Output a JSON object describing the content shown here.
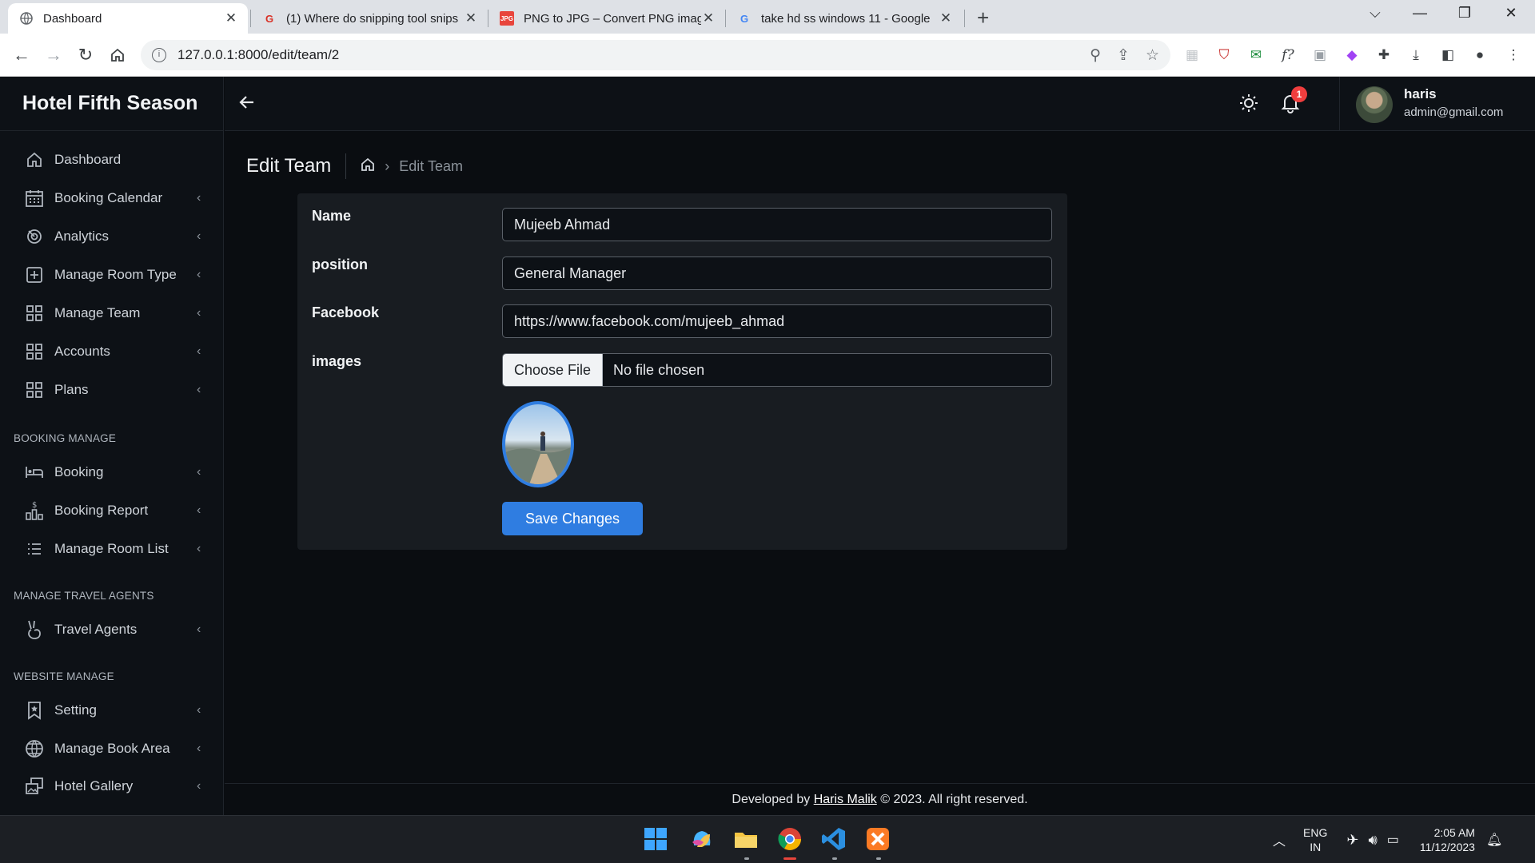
{
  "browser": {
    "tabs": [
      {
        "title": "Dashboard",
        "icon": "globe-icon"
      },
      {
        "title": "(1) Where do snipping tool snips",
        "icon": "quora-icon"
      },
      {
        "title": "PNG to JPG – Convert PNG images",
        "icon": "png-jpg-icon"
      },
      {
        "title": "take hd ss windows 11 - Google",
        "icon": "google-icon"
      }
    ],
    "url": "127.0.0.1:8000/edit/team/2"
  },
  "app": {
    "brand": "Hotel Fifth Season",
    "user": {
      "name": "haris",
      "email": "admin@gmail.com"
    },
    "notification_count": "1"
  },
  "sidebar": {
    "items": [
      {
        "label": "Dashboard",
        "icon": "home-icon"
      },
      {
        "label": "Booking Calendar",
        "icon": "calendar-icon"
      },
      {
        "label": "Analytics",
        "icon": "analytics-icon"
      },
      {
        "label": "Manage Room Type",
        "icon": "plus-box-icon"
      },
      {
        "label": "Manage Team",
        "icon": "grid-icon"
      },
      {
        "label": "Accounts",
        "icon": "grid-icon"
      },
      {
        "label": "Plans",
        "icon": "grid-icon"
      },
      {
        "label": "Booking",
        "icon": "bed-icon"
      },
      {
        "label": "Booking Report",
        "icon": "report-icon"
      },
      {
        "label": "Manage Room List",
        "icon": "list-icon"
      },
      {
        "label": "Travel Agents",
        "icon": "hand-icon"
      },
      {
        "label": "Setting",
        "icon": "bookmark-icon"
      },
      {
        "label": "Manage Book Area",
        "icon": "globe-icon"
      },
      {
        "label": "Hotel Gallery",
        "icon": "gallery-icon"
      }
    ],
    "sections": [
      "BOOKING MANAGE",
      "MANAGE TRAVEL AGENTS",
      "WEBSITE MANAGE"
    ]
  },
  "page": {
    "title": "Edit Team",
    "breadcrumb_current": "Edit Team"
  },
  "form": {
    "name_label": "Name",
    "name_value": "Mujeeb Ahmad",
    "position_label": "position",
    "position_value": "General Manager",
    "facebook_label": "Facebook",
    "facebook_value": "https://www.facebook.com/mujeeb_ahmad",
    "images_label": "images",
    "file_button": "Choose File",
    "file_status": "No file chosen",
    "save_button": "Save Changes"
  },
  "footer": {
    "prefix": "Developed by",
    "author": "Haris Malik",
    "suffix": "© 2023. All right reserved."
  },
  "taskbar": {
    "lang_top": "ENG",
    "lang_bottom": "IN",
    "time": "2:05 AM",
    "date": "11/12/2023"
  },
  "colors": {
    "accent": "#2f7de1",
    "background": "#0a0d11",
    "panel": "#181c21",
    "badge": "#f03e3e"
  }
}
